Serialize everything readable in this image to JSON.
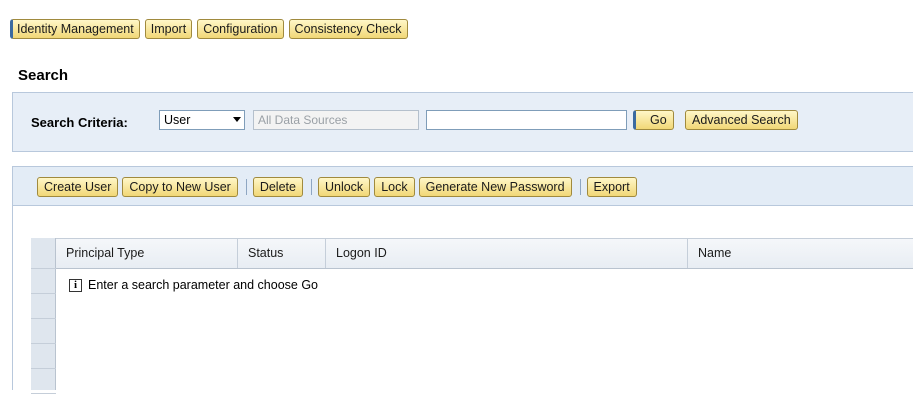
{
  "topnav": {
    "tabs": [
      {
        "label": "Identity Management"
      },
      {
        "label": "Import"
      },
      {
        "label": "Configuration"
      },
      {
        "label": "Consistency Check"
      }
    ]
  },
  "page": {
    "title": "Search"
  },
  "search": {
    "criteria_label": "Search Criteria:",
    "type_selected": "User",
    "data_sources_placeholder": "All Data Sources",
    "query_value": "",
    "go_label": "Go",
    "advanced_label": "Advanced Search"
  },
  "toolbar": {
    "create_user": "Create User",
    "copy_to_new_user": "Copy to New User",
    "delete": "Delete",
    "unlock": "Unlock",
    "lock": "Lock",
    "generate_new_password": "Generate New Password",
    "export": "Export"
  },
  "table": {
    "columns": [
      "Principal Type",
      "Status",
      "Logon ID",
      "Name"
    ],
    "empty_message": "Enter a search parameter and choose Go",
    "info_icon_glyph": "i"
  },
  "colors": {
    "button_fill": "#f1d777",
    "panel_bg": "#e7eef7",
    "emphasis_blue": "#3b6aa0"
  }
}
